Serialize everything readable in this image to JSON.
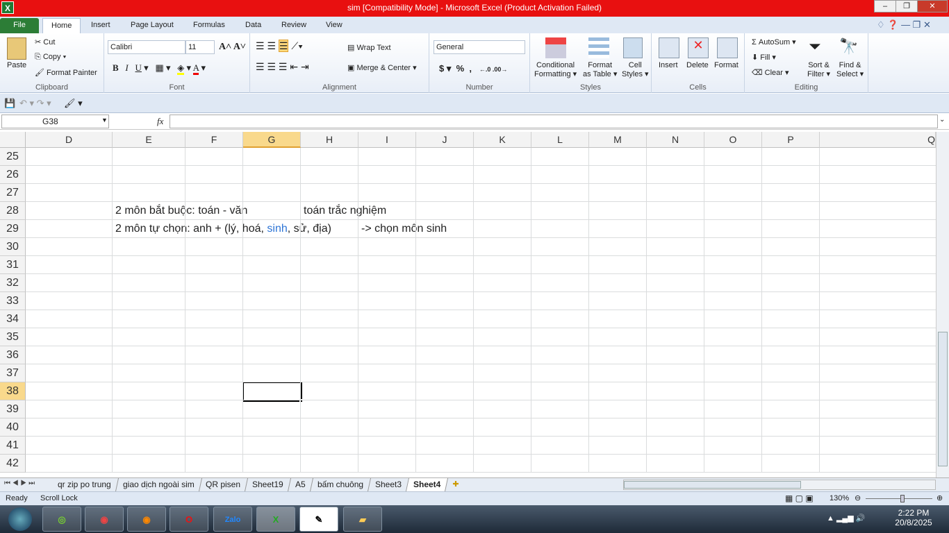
{
  "window": {
    "title": "sim  [Compatibility Mode]  -  Microsoft Excel (Product Activation Failed)"
  },
  "tabs": [
    "File",
    "Home",
    "Insert",
    "Page Layout",
    "Formulas",
    "Data",
    "Review",
    "View"
  ],
  "ribbon": {
    "clipboard": {
      "label": "Clipboard",
      "paste": "Paste",
      "cut": "Cut",
      "copy": "Copy",
      "format_painter": "Format Painter"
    },
    "font": {
      "label": "Font",
      "name": "Calibri",
      "size": "11"
    },
    "alignment": {
      "label": "Alignment",
      "wrap": "Wrap Text",
      "merge": "Merge & Center"
    },
    "number": {
      "label": "Number",
      "format": "General",
      "currency": "$",
      "percent": "%",
      "comma": ","
    },
    "styles": {
      "label": "Styles",
      "conditional": "Conditional",
      "conditional2": "Formatting",
      "format_table": "Format",
      "format_table2": "as Table",
      "cell_styles": "Cell",
      "cell_styles2": "Styles"
    },
    "cells": {
      "label": "Cells",
      "insert": "Insert",
      "delete": "Delete",
      "format": "Format"
    },
    "editing": {
      "label": "Editing",
      "autosum": "AutoSum",
      "fill": "Fill",
      "clear": "Clear",
      "sort": "Sort &",
      "sort2": "Filter",
      "find": "Find &",
      "find2": "Select"
    }
  },
  "formula_bar": {
    "name_box": "G38",
    "fx": "fx",
    "value": ""
  },
  "columns": [
    "D",
    "E",
    "F",
    "G",
    "H",
    "I",
    "J",
    "K",
    "L",
    "M",
    "N",
    "O",
    "P",
    "Q"
  ],
  "selected_column": "G",
  "rows": [
    "25",
    "26",
    "27",
    "28",
    "29",
    "30",
    "31",
    "32",
    "33",
    "34",
    "35",
    "36",
    "37",
    "38",
    "39",
    "40",
    "41",
    "42"
  ],
  "selected_row": "38",
  "cells": {
    "e28": "2 môn bắt buộc:  toán - văn",
    "h28": "toán trắc nghiệm",
    "e29_a": "2 môn tự chọn: anh + (lý, hoá, ",
    "e29_b": "sinh",
    "e29_c": ", sử, địa)",
    "i29": "-> chọn môn sinh",
    "highlight_color": "#2e75d6"
  },
  "sheets": [
    "qr zip po trung",
    "giao dịch ngoài sim",
    "QR pisen",
    "Sheet19",
    "A5",
    "bấm chuông",
    "Sheet3",
    "Sheet4"
  ],
  "active_sheet": "Sheet4",
  "status": {
    "ready": "Ready",
    "scroll_lock": "Scroll Lock",
    "zoom": "130%"
  },
  "taskbar": {
    "time": "2:22 PM",
    "date": "20/8/2025",
    "apps": [
      "coc-coc",
      "chrome",
      "firefox",
      "opera",
      "zalo",
      "excel",
      "app",
      "file-explorer"
    ]
  }
}
